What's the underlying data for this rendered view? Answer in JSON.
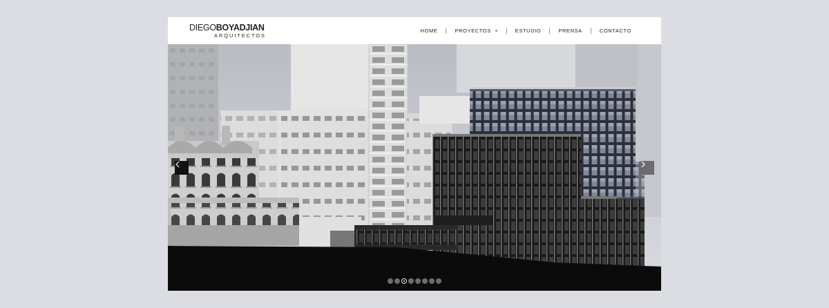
{
  "logo": {
    "light": "DIEGO",
    "bold": "BOYADJIAN",
    "subtitle": "ARQUITECTOS"
  },
  "nav": {
    "items": [
      {
        "label": "HOME"
      },
      {
        "label": "PROYECTOS",
        "icon": "chevron-down-icon"
      },
      {
        "label": "ESTUDIO"
      },
      {
        "label": "PRENSA"
      },
      {
        "label": "CONTACTO"
      }
    ]
  },
  "slider": {
    "slide_count": 8,
    "active_slide": 3,
    "prev_icon": "chevron-left-icon",
    "next_icon": "chevron-right-icon"
  },
  "colors": {
    "page_background": "#dcdde2",
    "ground": "#0b0b0b",
    "accent_dark": "#111111"
  }
}
